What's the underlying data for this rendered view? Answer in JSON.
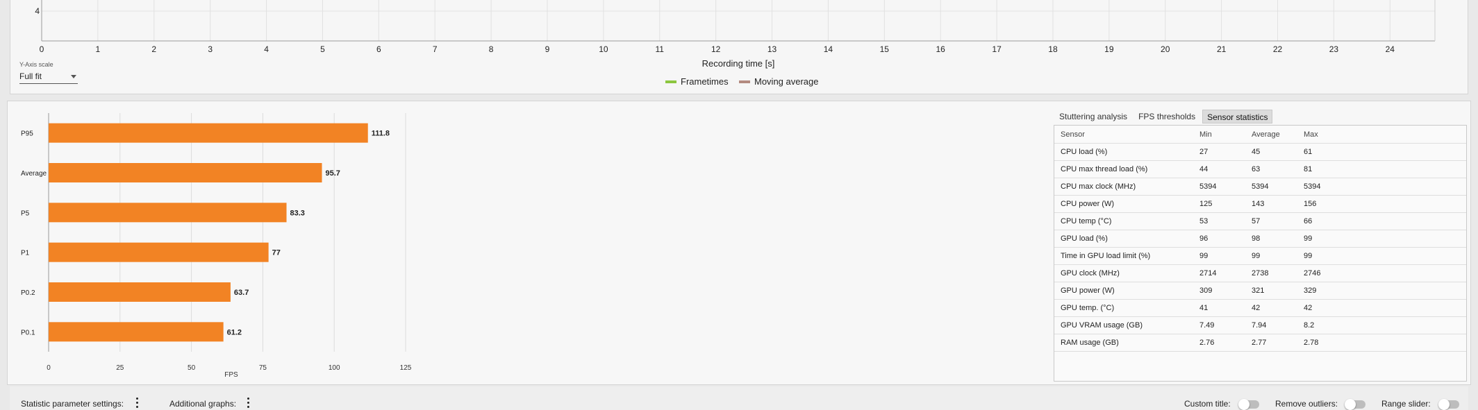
{
  "frametime_chart": {
    "y_tick_visible": "4",
    "x_ticks": [
      "0",
      "1",
      "2",
      "3",
      "4",
      "5",
      "6",
      "7",
      "8",
      "9",
      "10",
      "11",
      "12",
      "13",
      "14",
      "15",
      "16",
      "17",
      "18",
      "19",
      "20",
      "21",
      "22",
      "23",
      "24"
    ],
    "xlabel": "Recording time [s]",
    "x_range": [
      0,
      24.8
    ],
    "legend": [
      {
        "label": "Frametimes",
        "color": "#8cc63f"
      },
      {
        "label": "Moving average",
        "color": "#b38a80"
      }
    ]
  },
  "y_axis_scale": {
    "label": "Y-Axis scale",
    "value": "Full fit"
  },
  "chart_data": {
    "type": "bar",
    "orientation": "horizontal",
    "categories": [
      "P95",
      "Average",
      "P5",
      "P1",
      "P0.2",
      "P0.1"
    ],
    "values": [
      111.8,
      95.7,
      83.3,
      77,
      63.7,
      61.2
    ],
    "value_labels": [
      "111.8",
      "95.7",
      "83.3",
      "77",
      "63.7",
      "61.2"
    ],
    "xlabel": "FPS",
    "x_ticks": [
      "0",
      "25",
      "50",
      "75",
      "100",
      "125"
    ],
    "xlim": [
      0,
      125
    ],
    "bar_color": "#f28324",
    "grid": true
  },
  "tabs": [
    {
      "label": "Stuttering analysis",
      "active": false
    },
    {
      "label": "FPS thresholds",
      "active": false
    },
    {
      "label": "Sensor statistics",
      "active": true
    }
  ],
  "sensor_table": {
    "columns": [
      "Sensor",
      "Min",
      "Average",
      "Max"
    ],
    "rows": [
      [
        "CPU load (%)",
        "27",
        "45",
        "61"
      ],
      [
        "CPU max thread load (%)",
        "44",
        "63",
        "81"
      ],
      [
        "CPU max clock (MHz)",
        "5394",
        "5394",
        "5394"
      ],
      [
        "CPU power (W)",
        "125",
        "143",
        "156"
      ],
      [
        "CPU temp (°C)",
        "53",
        "57",
        "66"
      ],
      [
        "GPU load (%)",
        "96",
        "98",
        "99"
      ],
      [
        "Time in GPU load limit (%)",
        "99",
        "99",
        "99"
      ],
      [
        "GPU clock (MHz)",
        "2714",
        "2738",
        "2746"
      ],
      [
        "GPU power (W)",
        "309",
        "321",
        "329"
      ],
      [
        "GPU temp. (°C)",
        "41",
        "42",
        "42"
      ],
      [
        "GPU VRAM usage (GB)",
        "7.49",
        "7.94",
        "8.2"
      ],
      [
        "RAM usage (GB)",
        "2.76",
        "2.77",
        "2.78"
      ]
    ]
  },
  "bottom_bar": {
    "statistic_settings_label": "Statistic parameter settings:",
    "additional_graphs_label": "Additional graphs:",
    "custom_title_label": "Custom title:",
    "remove_outliers_label": "Remove outliers:",
    "range_slider_label": "Range slider:"
  }
}
